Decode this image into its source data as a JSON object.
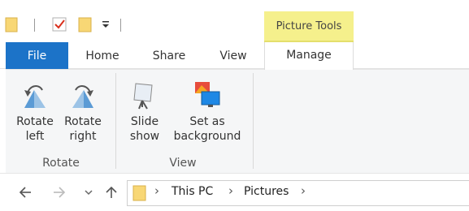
{
  "titlebar": {
    "qat_icons": [
      "folder-icon",
      "properties-icon",
      "new-folder-icon",
      "customize-qat-icon"
    ],
    "context_tab": "Picture Tools"
  },
  "tabs": {
    "file": "File",
    "home": "Home",
    "share": "Share",
    "view": "View",
    "manage": "Manage",
    "active": "Manage"
  },
  "ribbon": {
    "groups": [
      {
        "label": "Rotate",
        "commands": [
          {
            "label": "Rotate\nleft",
            "icon": "rotate-left-icon"
          },
          {
            "label": "Rotate\nright",
            "icon": "rotate-right-icon"
          }
        ]
      },
      {
        "label": "View",
        "commands": [
          {
            "label": "Slide\nshow",
            "icon": "slideshow-icon"
          },
          {
            "label": "Set as\nbackground",
            "icon": "set-background-icon"
          }
        ]
      }
    ]
  },
  "navbar": {
    "path": [
      "This PC",
      "Pictures"
    ]
  },
  "colors": {
    "file_tab": "#1c73c8",
    "context_tab": "#f5f08c",
    "ribbon_bg": "#f5f6f7"
  }
}
